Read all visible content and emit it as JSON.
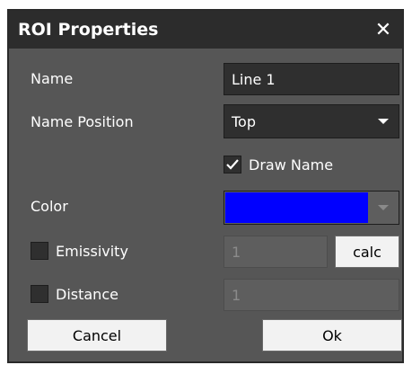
{
  "window": {
    "title": "ROI Properties",
    "close_icon": "close-icon"
  },
  "form": {
    "name_label": "Name",
    "name_value": "Line 1",
    "name_position_label": "Name Position",
    "name_position_value": "Top",
    "draw_name_label": "Draw Name",
    "draw_name_checked": true,
    "color_label": "Color",
    "color_value": "#0000ff",
    "emissivity_label": "Emissivity",
    "emissivity_checked": false,
    "emissivity_value": "1",
    "calc_label": "calc",
    "distance_label": "Distance",
    "distance_checked": false,
    "distance_value": "1"
  },
  "buttons": {
    "cancel": "Cancel",
    "ok": "Ok"
  }
}
